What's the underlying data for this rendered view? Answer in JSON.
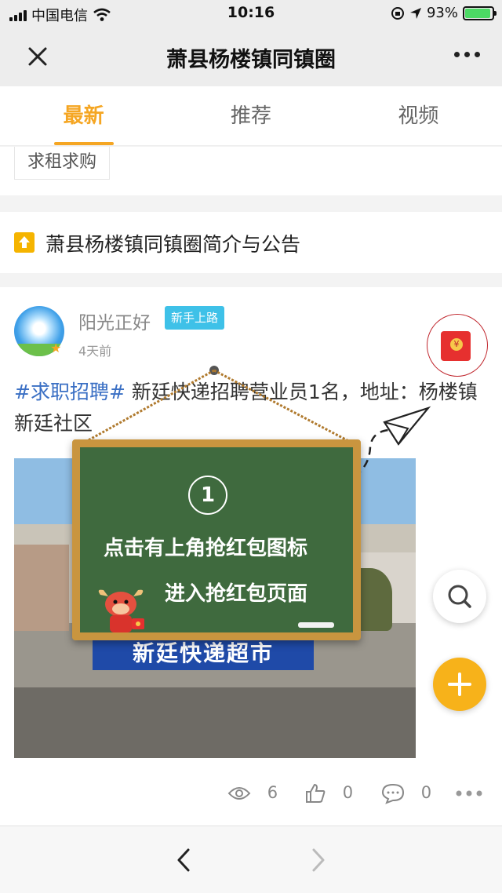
{
  "status_bar": {
    "carrier": "中国电信",
    "time": "10:16",
    "battery": "93%",
    "battery_level": 0.93
  },
  "nav": {
    "title": "萧县杨楼镇同镇圈"
  },
  "tabs": [
    {
      "label": "最新",
      "active": true
    },
    {
      "label": "推荐"
    },
    {
      "label": "视频"
    }
  ],
  "category_tag": "求租求购",
  "notice": {
    "text": "萧县杨楼镇同镇圈简介与公告"
  },
  "post": {
    "author": "阳光正好",
    "badge": "新手上路",
    "time": "4天前",
    "hashtag": "#求职招聘#",
    "body": " 新廷快递招聘营业员1名，地址：杨楼镇新廷社区",
    "photo_sign": "新廷快递超市",
    "views": "6",
    "likes": "0",
    "comments": "0"
  },
  "tutorial": {
    "step": "1",
    "line1": "点击有上角抢红包图标",
    "line2": "进入抢红包页面"
  },
  "colors": {
    "accent": "#f5a623",
    "hashtag": "#3a6fc4",
    "badge": "#3ec1e8",
    "board": "#3f6a3e",
    "frame": "#c9953f"
  }
}
